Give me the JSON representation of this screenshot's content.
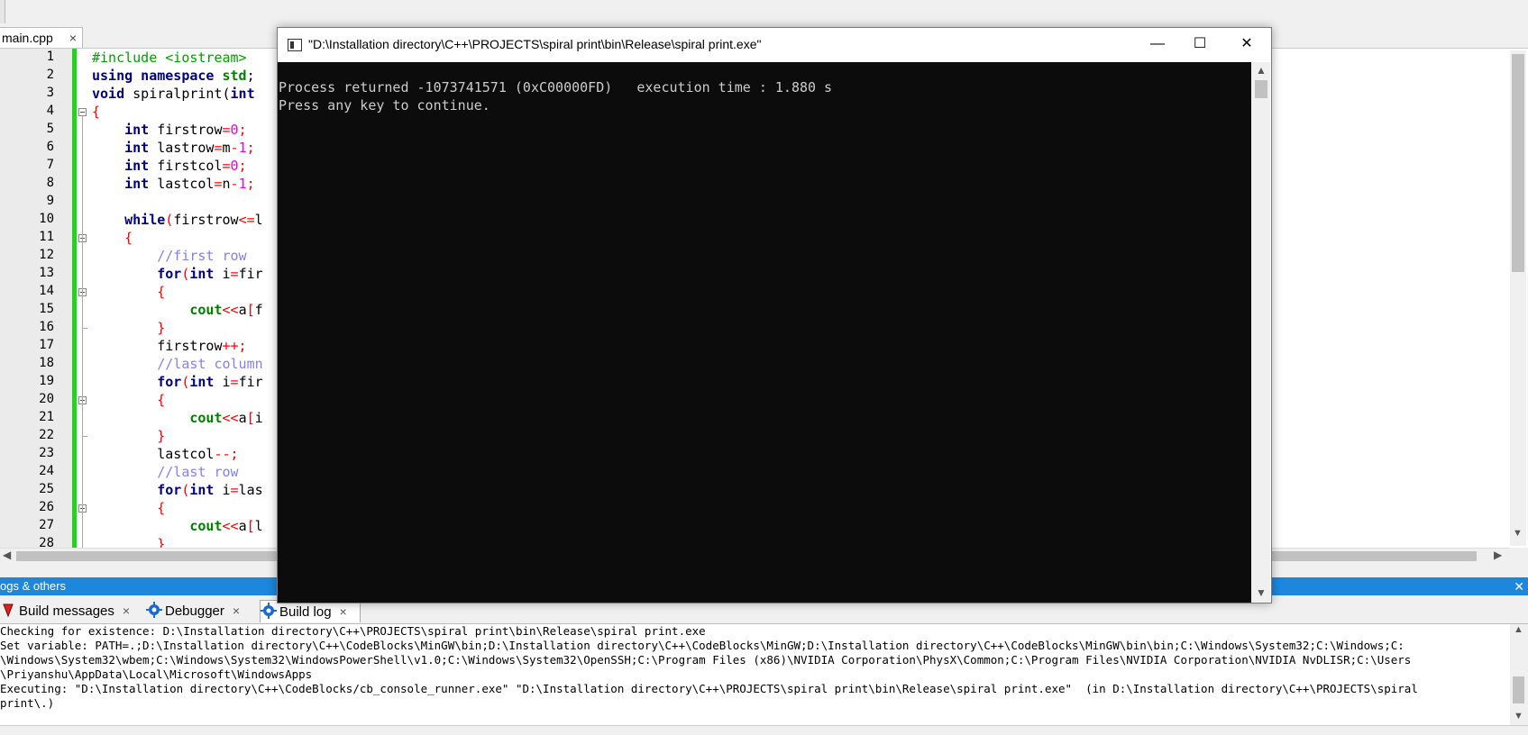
{
  "editor": {
    "tab_label": "main.cpp",
    "tab_close": "×",
    "lines": [
      {
        "n": "1",
        "segs": [
          {
            "c": "pp",
            "t": "#include <iostream>"
          }
        ]
      },
      {
        "n": "2",
        "segs": [
          {
            "c": "kw",
            "t": "using namespace "
          },
          {
            "c": "kg",
            "t": "std"
          },
          {
            "c": "",
            "t": ";"
          }
        ]
      },
      {
        "n": "3",
        "segs": [
          {
            "c": "kw",
            "t": "void"
          },
          {
            "c": "",
            "t": " spiralprint("
          },
          {
            "c": "kw",
            "t": "int"
          }
        ]
      },
      {
        "n": "4",
        "segs": [
          {
            "c": "op",
            "t": "{"
          }
        ]
      },
      {
        "n": "5",
        "segs": [
          {
            "c": "",
            "t": "    "
          },
          {
            "c": "kw",
            "t": "int"
          },
          {
            "c": "",
            "t": " firstrow"
          },
          {
            "c": "op",
            "t": "="
          },
          {
            "c": "num",
            "t": "0"
          },
          {
            "c": "op",
            "t": ";"
          }
        ]
      },
      {
        "n": "6",
        "segs": [
          {
            "c": "",
            "t": "    "
          },
          {
            "c": "kw",
            "t": "int"
          },
          {
            "c": "",
            "t": " lastrow"
          },
          {
            "c": "op",
            "t": "="
          },
          {
            "c": "",
            "t": "m"
          },
          {
            "c": "op",
            "t": "-"
          },
          {
            "c": "num",
            "t": "1"
          },
          {
            "c": "op",
            "t": ";"
          }
        ]
      },
      {
        "n": "7",
        "segs": [
          {
            "c": "",
            "t": "    "
          },
          {
            "c": "kw",
            "t": "int"
          },
          {
            "c": "",
            "t": " firstcol"
          },
          {
            "c": "op",
            "t": "="
          },
          {
            "c": "num",
            "t": "0"
          },
          {
            "c": "op",
            "t": ";"
          }
        ]
      },
      {
        "n": "8",
        "segs": [
          {
            "c": "",
            "t": "    "
          },
          {
            "c": "kw",
            "t": "int"
          },
          {
            "c": "",
            "t": " lastcol"
          },
          {
            "c": "op",
            "t": "="
          },
          {
            "c": "",
            "t": "n"
          },
          {
            "c": "op",
            "t": "-"
          },
          {
            "c": "num",
            "t": "1"
          },
          {
            "c": "op",
            "t": ";"
          }
        ]
      },
      {
        "n": "9",
        "segs": []
      },
      {
        "n": "10",
        "segs": [
          {
            "c": "",
            "t": "    "
          },
          {
            "c": "kw",
            "t": "while"
          },
          {
            "c": "op",
            "t": "("
          },
          {
            "c": "",
            "t": "firstrow"
          },
          {
            "c": "op",
            "t": "<="
          },
          {
            "c": "",
            "t": "l"
          }
        ]
      },
      {
        "n": "11",
        "segs": [
          {
            "c": "",
            "t": "    "
          },
          {
            "c": "op",
            "t": "{"
          }
        ]
      },
      {
        "n": "12",
        "segs": [
          {
            "c": "",
            "t": "        "
          },
          {
            "c": "cm",
            "t": "//first row"
          }
        ]
      },
      {
        "n": "13",
        "segs": [
          {
            "c": "",
            "t": "        "
          },
          {
            "c": "kw",
            "t": "for"
          },
          {
            "c": "op",
            "t": "("
          },
          {
            "c": "kw",
            "t": "int"
          },
          {
            "c": "",
            "t": " i"
          },
          {
            "c": "op",
            "t": "="
          },
          {
            "c": "",
            "t": "fir"
          }
        ]
      },
      {
        "n": "14",
        "segs": [
          {
            "c": "",
            "t": "        "
          },
          {
            "c": "op",
            "t": "{"
          }
        ]
      },
      {
        "n": "15",
        "segs": [
          {
            "c": "",
            "t": "            "
          },
          {
            "c": "kg",
            "t": "cout"
          },
          {
            "c": "op",
            "t": "<<"
          },
          {
            "c": "",
            "t": "a"
          },
          {
            "c": "op",
            "t": "["
          },
          {
            "c": "",
            "t": "f"
          }
        ]
      },
      {
        "n": "16",
        "segs": [
          {
            "c": "",
            "t": "        "
          },
          {
            "c": "op",
            "t": "}"
          }
        ]
      },
      {
        "n": "17",
        "segs": [
          {
            "c": "",
            "t": "        firstrow"
          },
          {
            "c": "op",
            "t": "++;"
          }
        ]
      },
      {
        "n": "18",
        "segs": [
          {
            "c": "",
            "t": "        "
          },
          {
            "c": "cm",
            "t": "//last column"
          }
        ]
      },
      {
        "n": "19",
        "segs": [
          {
            "c": "",
            "t": "        "
          },
          {
            "c": "kw",
            "t": "for"
          },
          {
            "c": "op",
            "t": "("
          },
          {
            "c": "kw",
            "t": "int"
          },
          {
            "c": "",
            "t": " i"
          },
          {
            "c": "op",
            "t": "="
          },
          {
            "c": "",
            "t": "fir"
          }
        ]
      },
      {
        "n": "20",
        "segs": [
          {
            "c": "",
            "t": "        "
          },
          {
            "c": "op",
            "t": "{"
          }
        ]
      },
      {
        "n": "21",
        "segs": [
          {
            "c": "",
            "t": "            "
          },
          {
            "c": "kg",
            "t": "cout"
          },
          {
            "c": "op",
            "t": "<<"
          },
          {
            "c": "",
            "t": "a"
          },
          {
            "c": "op",
            "t": "["
          },
          {
            "c": "",
            "t": "i"
          }
        ]
      },
      {
        "n": "22",
        "segs": [
          {
            "c": "",
            "t": "        "
          },
          {
            "c": "op",
            "t": "}"
          }
        ]
      },
      {
        "n": "23",
        "segs": [
          {
            "c": "",
            "t": "        lastcol"
          },
          {
            "c": "op",
            "t": "--;"
          }
        ]
      },
      {
        "n": "24",
        "segs": [
          {
            "c": "",
            "t": "        "
          },
          {
            "c": "cm",
            "t": "//last row"
          }
        ]
      },
      {
        "n": "25",
        "segs": [
          {
            "c": "",
            "t": "        "
          },
          {
            "c": "kw",
            "t": "for"
          },
          {
            "c": "op",
            "t": "("
          },
          {
            "c": "kw",
            "t": "int"
          },
          {
            "c": "",
            "t": " i"
          },
          {
            "c": "op",
            "t": "="
          },
          {
            "c": "",
            "t": "las"
          }
        ]
      },
      {
        "n": "26",
        "segs": [
          {
            "c": "",
            "t": "        "
          },
          {
            "c": "op",
            "t": "{"
          }
        ]
      },
      {
        "n": "27",
        "segs": [
          {
            "c": "",
            "t": "            "
          },
          {
            "c": "kg",
            "t": "cout"
          },
          {
            "c": "op",
            "t": "<<"
          },
          {
            "c": "",
            "t": "a"
          },
          {
            "c": "op",
            "t": "["
          },
          {
            "c": "",
            "t": "l"
          }
        ]
      },
      {
        "n": "28",
        "segs": [
          {
            "c": "",
            "t": "        "
          },
          {
            "c": "op",
            "t": "}"
          }
        ]
      }
    ]
  },
  "console": {
    "title": "\"D:\\Installation directory\\C++\\PROJECTS\\spiral print\\bin\\Release\\spiral print.exe\"",
    "minimize": "—",
    "maximize": "☐",
    "close": "✕",
    "output": [
      "Process returned -1073741571 (0xC00000FD)   execution time : 1.880 s",
      "Press any key to continue."
    ]
  },
  "logs": {
    "title": "ogs & others",
    "close": "✕",
    "tabs": [
      {
        "label": "Build messages",
        "icon": "build-messages-icon",
        "active": false
      },
      {
        "label": "Debugger",
        "icon": "gear-icon",
        "active": false
      },
      {
        "label": "Build log",
        "icon": "gear-icon",
        "active": true
      }
    ],
    "tab_close": "×",
    "lines": [
      "Checking for existence: D:\\Installation directory\\C++\\PROJECTS\\spiral print\\bin\\Release\\spiral print.exe",
      "Set variable: PATH=.;D:\\Installation directory\\C++\\CodeBlocks\\MinGW\\bin;D:\\Installation directory\\C++\\CodeBlocks\\MinGW;D:\\Installation directory\\C++\\CodeBlocks\\MinGW\\bin\\bin;C:\\Windows\\System32;C:\\Windows;C:",
      "\\Windows\\System32\\wbem;C:\\Windows\\System32\\WindowsPowerShell\\v1.0;C:\\Windows\\System32\\OpenSSH;C:\\Program Files (x86)\\NVIDIA Corporation\\PhysX\\Common;C:\\Program Files\\NVIDIA Corporation\\NVIDIA NvDLISR;C:\\Users",
      "\\Priyanshu\\AppData\\Local\\Microsoft\\WindowsApps",
      "Executing: \"D:\\Installation directory\\C++\\CodeBlocks/cb_console_runner.exe\" \"D:\\Installation directory\\C++\\PROJECTS\\spiral print\\bin\\Release\\spiral print.exe\"  (in D:\\Installation directory\\C++\\PROJECTS\\spiral",
      "print\\.)"
    ]
  },
  "colors": {
    "console_bg": "#0c0c0c",
    "console_text": "#cccccc",
    "logs_header": "#1c87dd",
    "change_bar": "#22d322"
  }
}
